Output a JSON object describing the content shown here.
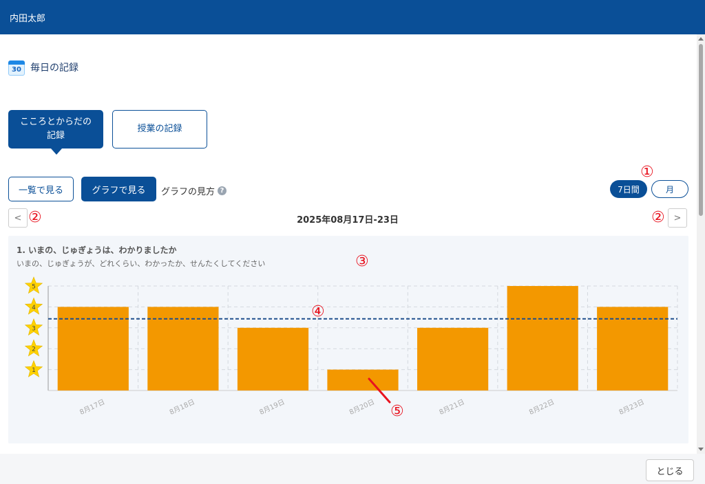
{
  "header": {
    "user_name": "内田太郎"
  },
  "page": {
    "title": "毎日の記録",
    "calendar_day": "30"
  },
  "tabs": [
    {
      "label": "こころとからだの記録",
      "active": true
    },
    {
      "label": "授業の記録",
      "active": false
    }
  ],
  "view_toggle": {
    "list_label": "一覧で見る",
    "graph_label": "グラフで見る",
    "help_label": "グラフの見方",
    "help_icon": "?"
  },
  "period": {
    "week_label": "7日間",
    "month_label": "月",
    "selected": "7日間"
  },
  "navigation": {
    "prev": "<",
    "next": ">",
    "date_range": "2025年08月17日-23日"
  },
  "markers": {
    "m1": "①",
    "m2": "②",
    "m3": "③",
    "m4": "④",
    "m5": "⑤"
  },
  "question": {
    "title": "1. いまの、じゅぎょうは、わかりましたか",
    "subtitle": "いまの、じゅぎょうが、どれくらい、わかったか、せんたくしてください"
  },
  "chart_data": {
    "type": "bar",
    "categories": [
      "8月17日",
      "8月18日",
      "8月19日",
      "8月20日",
      "8月21日",
      "8月22日",
      "8月23日"
    ],
    "values": [
      4,
      4,
      3,
      1,
      3,
      5,
      4
    ],
    "average": 3.43,
    "ylim": [
      0,
      5
    ],
    "y_ticks": [
      "1",
      "2",
      "3",
      "4",
      "5"
    ],
    "y_tick_icon": "star-icon",
    "grid": true,
    "colors": {
      "bar": "#f39800",
      "average_line": "#1f4e8c",
      "star": "#ffd200"
    }
  },
  "footer": {
    "close_label": "とじる"
  }
}
